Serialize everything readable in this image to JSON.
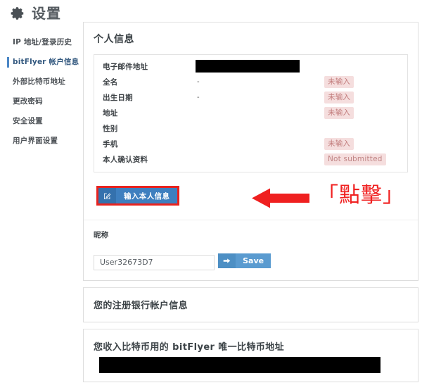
{
  "header": {
    "title": "设置",
    "icon": "gear-icon"
  },
  "sidebar": {
    "items": [
      {
        "label": "IP 地址/登录历史",
        "active": false
      },
      {
        "label": "bitFlyer 帐户信息",
        "active": true
      },
      {
        "label": "外部比特币地址",
        "active": false
      },
      {
        "label": "更改密码",
        "active": false
      },
      {
        "label": "安全设置",
        "active": false
      },
      {
        "label": "用户界面设置",
        "active": false
      }
    ]
  },
  "personal_info": {
    "panel_title": "个人信息",
    "rows": [
      {
        "label": "电子邮件地址",
        "value": "",
        "redacted": true,
        "status": ""
      },
      {
        "label": "全名",
        "value": "-",
        "redacted": false,
        "status": "未输入"
      },
      {
        "label": "出生日期",
        "value": "-",
        "redacted": false,
        "status": "未输入"
      },
      {
        "label": "地址",
        "value": "",
        "redacted": false,
        "status": "未输入"
      },
      {
        "label": "性别",
        "value": "",
        "redacted": false,
        "status": ""
      },
      {
        "label": "手机",
        "value": "",
        "redacted": false,
        "status": "未输入"
      },
      {
        "label": "本人确认资料",
        "value": "",
        "redacted": false,
        "status": "Not submitted"
      }
    ],
    "edit_button": {
      "label": "输入本人信息",
      "icon": "pencil-square-icon"
    },
    "callout": {
      "text": "「點擊」",
      "arrow_icon": "arrow-left-icon",
      "color": "#f02020",
      "highlight_color": "#e8231f"
    }
  },
  "nickname": {
    "label": "昵称",
    "value": "User32673D7",
    "placeholder": "",
    "save_button": {
      "label": "Save",
      "icon": "arrow-right-icon"
    }
  },
  "bank_section": {
    "heading": "您的注册银行帐户信息"
  },
  "btc_section": {
    "heading": "您收入比特币用的 bitFlyer 唯一比特币地址",
    "address_redacted": true
  },
  "colors": {
    "accent_blue": "#3e7fbf",
    "badge_bg": "#f5dede",
    "badge_text": "#c27c7c",
    "callout_red": "#f02020"
  }
}
